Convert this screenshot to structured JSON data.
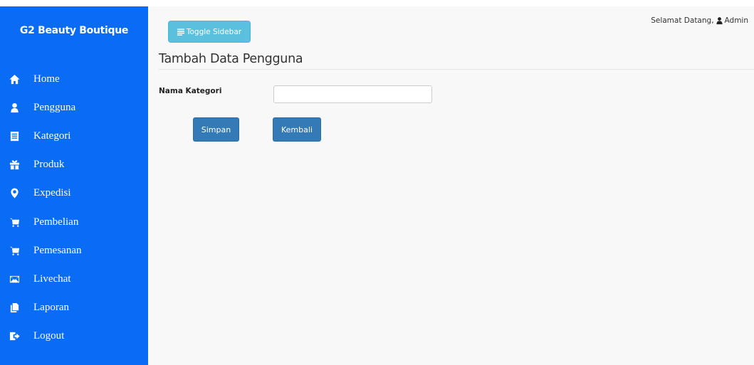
{
  "sidebar": {
    "brand": "G2 Beauty Boutique",
    "items": [
      {
        "label": "Home",
        "icon": "home-icon"
      },
      {
        "label": "Pengguna",
        "icon": "user-icon"
      },
      {
        "label": "Kategori",
        "icon": "list-alt-icon"
      },
      {
        "label": "Produk",
        "icon": "gift-icon"
      },
      {
        "label": "Expedisi",
        "icon": "map-marker-icon"
      },
      {
        "label": "Pembelian",
        "icon": "shopping-cart-icon"
      },
      {
        "label": "Pemesanan",
        "icon": "shopping-cart-icon"
      },
      {
        "label": "Livechat",
        "icon": "envelope-icon"
      },
      {
        "label": "Laporan",
        "icon": "documents-icon"
      },
      {
        "label": "Logout",
        "icon": "log-out-icon"
      }
    ]
  },
  "header": {
    "toggle_label": "Toggle Sidebar",
    "welcome_text": "Selamat Datang,",
    "username": "Admin"
  },
  "main": {
    "title": "Tambah Data Pengguna",
    "form": {
      "label": "Nama Kategori",
      "value": "",
      "save_label": "Simpan",
      "back_label": "Kembali"
    }
  }
}
